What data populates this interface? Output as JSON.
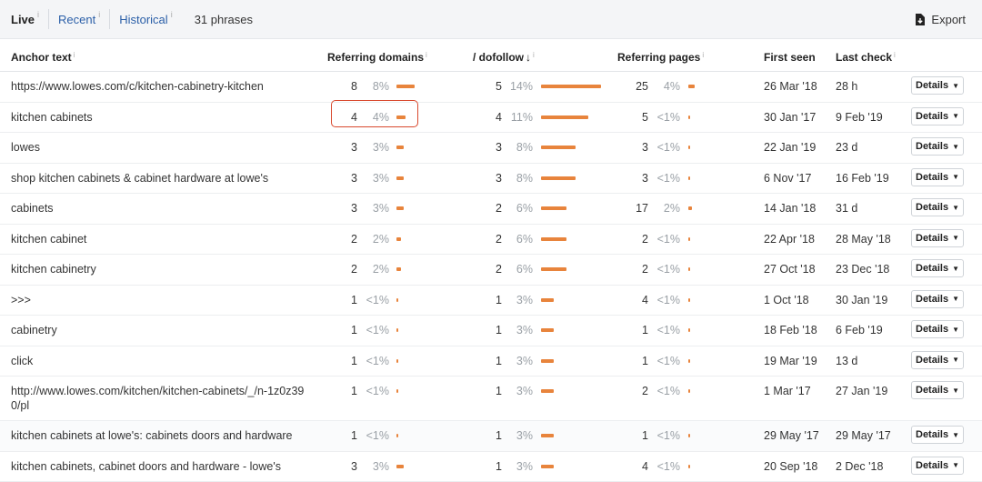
{
  "tabs": {
    "live": "Live",
    "recent": "Recent",
    "historical": "Historical",
    "info": "i",
    "phrases": "31 phrases",
    "export": "Export"
  },
  "columns": {
    "anchor": "Anchor text",
    "ref_domains": "Referring domains",
    "dofollow": "/ dofollow",
    "ref_pages": "Referring pages",
    "first_seen": "First seen",
    "last_check": "Last check",
    "info": "i"
  },
  "details_label": "Details",
  "accent": "#e8843c",
  "highlight_color": "#d9492e",
  "rows": [
    {
      "anchor": "https://www.lowes.com/c/kitchen-cabinetry-kitchen",
      "rd": "8",
      "rd_pct": "8%",
      "rd_frac": 0.08,
      "df": "5",
      "df_pct": "14%",
      "df_frac": 0.14,
      "rp": "25",
      "rp_pct": "4%",
      "rp_frac": 0.04,
      "first": "26 Mar '18",
      "last": "28 h"
    },
    {
      "anchor": "kitchen cabinets",
      "rd": "4",
      "rd_pct": "4%",
      "rd_frac": 0.04,
      "df": "4",
      "df_pct": "11%",
      "df_frac": 0.11,
      "rp": "5",
      "rp_pct": "<1%",
      "rp_frac": 0.005,
      "first": "30 Jan '17",
      "last": "9 Feb '19"
    },
    {
      "anchor": "lowes",
      "rd": "3",
      "rd_pct": "3%",
      "rd_frac": 0.03,
      "df": "3",
      "df_pct": "8%",
      "df_frac": 0.08,
      "rp": "3",
      "rp_pct": "<1%",
      "rp_frac": 0.005,
      "first": "22 Jan '19",
      "last": "23 d"
    },
    {
      "anchor": "shop kitchen cabinets & cabinet hardware at lowe's",
      "rd": "3",
      "rd_pct": "3%",
      "rd_frac": 0.03,
      "df": "3",
      "df_pct": "8%",
      "df_frac": 0.08,
      "rp": "3",
      "rp_pct": "<1%",
      "rp_frac": 0.005,
      "first": "6 Nov '17",
      "last": "16 Feb '19"
    },
    {
      "anchor": "cabinets",
      "rd": "3",
      "rd_pct": "3%",
      "rd_frac": 0.03,
      "df": "2",
      "df_pct": "6%",
      "df_frac": 0.06,
      "rp": "17",
      "rp_pct": "2%",
      "rp_frac": 0.02,
      "first": "14 Jan '18",
      "last": "31 d"
    },
    {
      "anchor": "kitchen cabinet",
      "rd": "2",
      "rd_pct": "2%",
      "rd_frac": 0.02,
      "df": "2",
      "df_pct": "6%",
      "df_frac": 0.06,
      "rp": "2",
      "rp_pct": "<1%",
      "rp_frac": 0.005,
      "first": "22 Apr '18",
      "last": "28 May '18"
    },
    {
      "anchor": "kitchen cabinetry",
      "rd": "2",
      "rd_pct": "2%",
      "rd_frac": 0.02,
      "df": "2",
      "df_pct": "6%",
      "df_frac": 0.06,
      "rp": "2",
      "rp_pct": "<1%",
      "rp_frac": 0.005,
      "first": "27 Oct '18",
      "last": "23 Dec '18"
    },
    {
      "anchor": ">>>",
      "rd": "1",
      "rd_pct": "<1%",
      "rd_frac": 0.005,
      "df": "1",
      "df_pct": "3%",
      "df_frac": 0.03,
      "rp": "4",
      "rp_pct": "<1%",
      "rp_frac": 0.005,
      "first": "1 Oct '18",
      "last": "30 Jan '19"
    },
    {
      "anchor": "cabinetry",
      "rd": "1",
      "rd_pct": "<1%",
      "rd_frac": 0.005,
      "df": "1",
      "df_pct": "3%",
      "df_frac": 0.03,
      "rp": "1",
      "rp_pct": "<1%",
      "rp_frac": 0.003,
      "first": "18 Feb '18",
      "last": "6 Feb '19"
    },
    {
      "anchor": "click",
      "rd": "1",
      "rd_pct": "<1%",
      "rd_frac": 0.005,
      "df": "1",
      "df_pct": "3%",
      "df_frac": 0.03,
      "rp": "1",
      "rp_pct": "<1%",
      "rp_frac": 0.003,
      "first": "19 Mar '19",
      "last": "13 d"
    },
    {
      "anchor": "http://www.lowes.com/kitchen/kitchen-cabinets/_/n-1z0z39 0/pl",
      "rd": "1",
      "rd_pct": "<1%",
      "rd_frac": 0.005,
      "df": "1",
      "df_pct": "3%",
      "df_frac": 0.03,
      "rp": "2",
      "rp_pct": "<1%",
      "rp_frac": 0.005,
      "first": "1 Mar '17",
      "last": "27 Jan '19"
    },
    {
      "anchor": "kitchen cabinets at lowe's: cabinets doors and hardware",
      "rd": "1",
      "rd_pct": "<1%",
      "rd_frac": 0.005,
      "df": "1",
      "df_pct": "3%",
      "df_frac": 0.03,
      "rp": "1",
      "rp_pct": "<1%",
      "rp_frac": 0.003,
      "first": "29 May '17",
      "last": "29 May '17"
    },
    {
      "anchor": "kitchen cabinets, cabinet doors and hardware - lowe's",
      "rd": "3",
      "rd_pct": "3%",
      "rd_frac": 0.03,
      "df": "1",
      "df_pct": "3%",
      "df_frac": 0.03,
      "rp": "4",
      "rp_pct": "<1%",
      "rp_frac": 0.005,
      "first": "20 Sep '18",
      "last": "2 Dec '18"
    }
  ]
}
